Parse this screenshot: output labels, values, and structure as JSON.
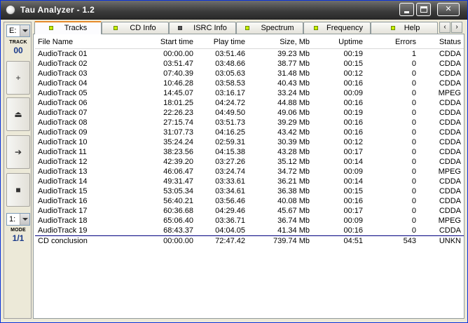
{
  "window": {
    "title": "Tau Analyzer - 1.2"
  },
  "left": {
    "drive": "E:",
    "track_label": "TRACK",
    "track_value": "00",
    "buttons": [
      {
        "name": "add-button",
        "glyph": "+"
      },
      {
        "name": "eject-button",
        "glyph": "⏏"
      },
      {
        "name": "play-button",
        "glyph": "➔"
      },
      {
        "name": "stop-button",
        "glyph": "■"
      }
    ],
    "mode_select": "1:",
    "mode_label": "MODE",
    "mode_value": "1/1"
  },
  "tabs": [
    {
      "label": "Tracks",
      "active": true,
      "led": "green"
    },
    {
      "label": "CD Info",
      "active": false,
      "led": "green"
    },
    {
      "label": "ISRC Info",
      "active": false,
      "led": "dark"
    },
    {
      "label": "Spectrum",
      "active": false,
      "led": "green"
    },
    {
      "label": "Frequency",
      "active": false,
      "led": "green"
    },
    {
      "label": "Help",
      "active": false,
      "led": "green"
    }
  ],
  "table": {
    "columns": [
      "File Name",
      "Start time",
      "Play time",
      "Size, Mb",
      "Uptime",
      "Errors",
      "Status"
    ],
    "rows": [
      [
        "AudioTrack 01",
        "00:00.00",
        "03:51.46",
        "39.23 Mb",
        "00:19",
        "1",
        "CDDA"
      ],
      [
        "AudioTrack 02",
        "03:51.47",
        "03:48.66",
        "38.77 Mb",
        "00:15",
        "0",
        "CDDA"
      ],
      [
        "AudioTrack 03",
        "07:40.39",
        "03:05.63",
        "31.48 Mb",
        "00:12",
        "0",
        "CDDA"
      ],
      [
        "AudioTrack 04",
        "10:46.28",
        "03:58.53",
        "40.43 Mb",
        "00:16",
        "0",
        "CDDA"
      ],
      [
        "AudioTrack 05",
        "14:45.07",
        "03:16.17",
        "33.24 Mb",
        "00:09",
        "0",
        "MPEG"
      ],
      [
        "AudioTrack 06",
        "18:01.25",
        "04:24.72",
        "44.88 Mb",
        "00:16",
        "0",
        "CDDA"
      ],
      [
        "AudioTrack 07",
        "22:26.23",
        "04:49.50",
        "49.06 Mb",
        "00:19",
        "0",
        "CDDA"
      ],
      [
        "AudioTrack 08",
        "27:15.74",
        "03:51.73",
        "39.29 Mb",
        "00:16",
        "0",
        "CDDA"
      ],
      [
        "AudioTrack 09",
        "31:07.73",
        "04:16.25",
        "43.42 Mb",
        "00:16",
        "0",
        "CDDA"
      ],
      [
        "AudioTrack 10",
        "35:24.24",
        "02:59.31",
        "30.39 Mb",
        "00:12",
        "0",
        "CDDA"
      ],
      [
        "AudioTrack 11",
        "38:23.56",
        "04:15.38",
        "43.28 Mb",
        "00:17",
        "0",
        "CDDA"
      ],
      [
        "AudioTrack 12",
        "42:39.20",
        "03:27.26",
        "35.12 Mb",
        "00:14",
        "0",
        "CDDA"
      ],
      [
        "AudioTrack 13",
        "46:06.47",
        "03:24.74",
        "34.72 Mb",
        "00:09",
        "0",
        "MPEG"
      ],
      [
        "AudioTrack 14",
        "49:31.47",
        "03:33.61",
        "36.21 Mb",
        "00:14",
        "0",
        "CDDA"
      ],
      [
        "AudioTrack 15",
        "53:05.34",
        "03:34.61",
        "36.38 Mb",
        "00:15",
        "0",
        "CDDA"
      ],
      [
        "AudioTrack 16",
        "56:40.21",
        "03:56.46",
        "40.08 Mb",
        "00:16",
        "0",
        "CDDA"
      ],
      [
        "AudioTrack 17",
        "60:36.68",
        "04:29.46",
        "45.67 Mb",
        "00:17",
        "0",
        "CDDA"
      ],
      [
        "AudioTrack 18",
        "65:06.40",
        "03:36.71",
        "36.74 Mb",
        "00:09",
        "0",
        "MPEG"
      ],
      [
        "AudioTrack 19",
        "68:43.37",
        "04:04.05",
        "41.34 Mb",
        "00:16",
        "0",
        "CDDA"
      ]
    ],
    "summary": [
      "CD conclusion",
      "00:00.00",
      "72:47.42",
      "739.74 Mb",
      "04:51",
      "543",
      "UNKN"
    ]
  }
}
